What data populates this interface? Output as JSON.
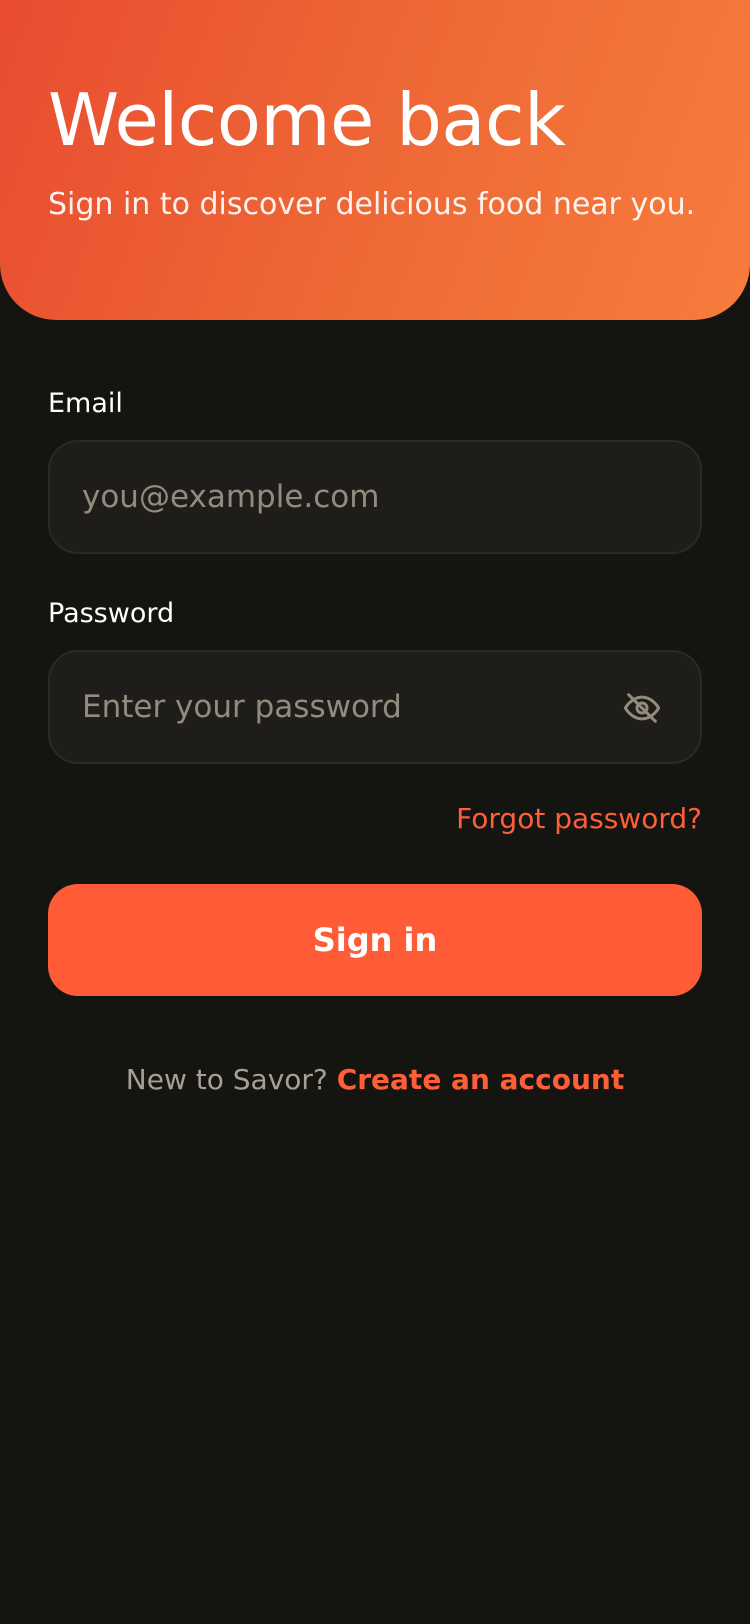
{
  "header": {
    "title": "Welcome back",
    "subtitle": "Sign in to discover delicious food near you."
  },
  "form": {
    "email": {
      "label": "Email",
      "value": "",
      "placeholder": "you@example.com"
    },
    "password": {
      "label": "Password",
      "value": "",
      "placeholder": "Enter your password",
      "toggle_icon": "eye-off-icon"
    },
    "forgot_label": "Forgot password?",
    "submit_label": "Sign in"
  },
  "footer": {
    "prompt": "New to Savor?",
    "link_label": "Create an account"
  },
  "colors": {
    "background": "#141411",
    "accent": "#ff5b36",
    "gradient_start": "#e84c30",
    "gradient_end": "#f67c3d",
    "input_background": "#1f1d19",
    "muted_text": "#a89f94"
  }
}
